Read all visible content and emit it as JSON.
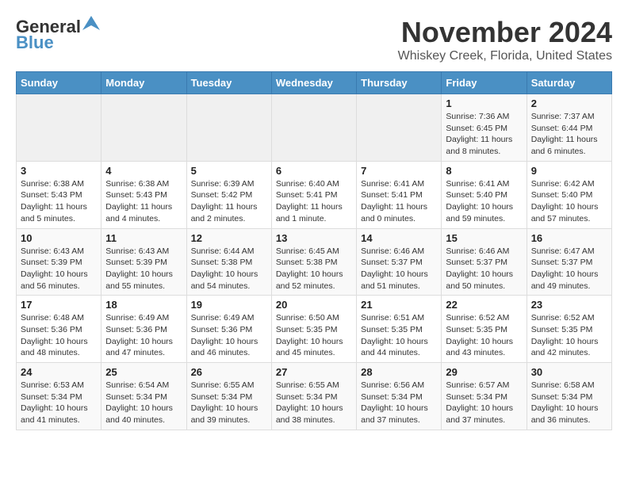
{
  "header": {
    "logo_general": "General",
    "logo_blue": "Blue",
    "month": "November 2024",
    "location": "Whiskey Creek, Florida, United States"
  },
  "weekdays": [
    "Sunday",
    "Monday",
    "Tuesday",
    "Wednesday",
    "Thursday",
    "Friday",
    "Saturday"
  ],
  "weeks": [
    [
      {
        "day": "",
        "info": ""
      },
      {
        "day": "",
        "info": ""
      },
      {
        "day": "",
        "info": ""
      },
      {
        "day": "",
        "info": ""
      },
      {
        "day": "",
        "info": ""
      },
      {
        "day": "1",
        "info": "Sunrise: 7:36 AM\nSunset: 6:45 PM\nDaylight: 11 hours\nand 8 minutes."
      },
      {
        "day": "2",
        "info": "Sunrise: 7:37 AM\nSunset: 6:44 PM\nDaylight: 11 hours\nand 6 minutes."
      }
    ],
    [
      {
        "day": "3",
        "info": "Sunrise: 6:38 AM\nSunset: 5:43 PM\nDaylight: 11 hours\nand 5 minutes."
      },
      {
        "day": "4",
        "info": "Sunrise: 6:38 AM\nSunset: 5:43 PM\nDaylight: 11 hours\nand 4 minutes."
      },
      {
        "day": "5",
        "info": "Sunrise: 6:39 AM\nSunset: 5:42 PM\nDaylight: 11 hours\nand 2 minutes."
      },
      {
        "day": "6",
        "info": "Sunrise: 6:40 AM\nSunset: 5:41 PM\nDaylight: 11 hours\nand 1 minute."
      },
      {
        "day": "7",
        "info": "Sunrise: 6:41 AM\nSunset: 5:41 PM\nDaylight: 11 hours\nand 0 minutes."
      },
      {
        "day": "8",
        "info": "Sunrise: 6:41 AM\nSunset: 5:40 PM\nDaylight: 10 hours\nand 59 minutes."
      },
      {
        "day": "9",
        "info": "Sunrise: 6:42 AM\nSunset: 5:40 PM\nDaylight: 10 hours\nand 57 minutes."
      }
    ],
    [
      {
        "day": "10",
        "info": "Sunrise: 6:43 AM\nSunset: 5:39 PM\nDaylight: 10 hours\nand 56 minutes."
      },
      {
        "day": "11",
        "info": "Sunrise: 6:43 AM\nSunset: 5:39 PM\nDaylight: 10 hours\nand 55 minutes."
      },
      {
        "day": "12",
        "info": "Sunrise: 6:44 AM\nSunset: 5:38 PM\nDaylight: 10 hours\nand 54 minutes."
      },
      {
        "day": "13",
        "info": "Sunrise: 6:45 AM\nSunset: 5:38 PM\nDaylight: 10 hours\nand 52 minutes."
      },
      {
        "day": "14",
        "info": "Sunrise: 6:46 AM\nSunset: 5:37 PM\nDaylight: 10 hours\nand 51 minutes."
      },
      {
        "day": "15",
        "info": "Sunrise: 6:46 AM\nSunset: 5:37 PM\nDaylight: 10 hours\nand 50 minutes."
      },
      {
        "day": "16",
        "info": "Sunrise: 6:47 AM\nSunset: 5:37 PM\nDaylight: 10 hours\nand 49 minutes."
      }
    ],
    [
      {
        "day": "17",
        "info": "Sunrise: 6:48 AM\nSunset: 5:36 PM\nDaylight: 10 hours\nand 48 minutes."
      },
      {
        "day": "18",
        "info": "Sunrise: 6:49 AM\nSunset: 5:36 PM\nDaylight: 10 hours\nand 47 minutes."
      },
      {
        "day": "19",
        "info": "Sunrise: 6:49 AM\nSunset: 5:36 PM\nDaylight: 10 hours\nand 46 minutes."
      },
      {
        "day": "20",
        "info": "Sunrise: 6:50 AM\nSunset: 5:35 PM\nDaylight: 10 hours\nand 45 minutes."
      },
      {
        "day": "21",
        "info": "Sunrise: 6:51 AM\nSunset: 5:35 PM\nDaylight: 10 hours\nand 44 minutes."
      },
      {
        "day": "22",
        "info": "Sunrise: 6:52 AM\nSunset: 5:35 PM\nDaylight: 10 hours\nand 43 minutes."
      },
      {
        "day": "23",
        "info": "Sunrise: 6:52 AM\nSunset: 5:35 PM\nDaylight: 10 hours\nand 42 minutes."
      }
    ],
    [
      {
        "day": "24",
        "info": "Sunrise: 6:53 AM\nSunset: 5:34 PM\nDaylight: 10 hours\nand 41 minutes."
      },
      {
        "day": "25",
        "info": "Sunrise: 6:54 AM\nSunset: 5:34 PM\nDaylight: 10 hours\nand 40 minutes."
      },
      {
        "day": "26",
        "info": "Sunrise: 6:55 AM\nSunset: 5:34 PM\nDaylight: 10 hours\nand 39 minutes."
      },
      {
        "day": "27",
        "info": "Sunrise: 6:55 AM\nSunset: 5:34 PM\nDaylight: 10 hours\nand 38 minutes."
      },
      {
        "day": "28",
        "info": "Sunrise: 6:56 AM\nSunset: 5:34 PM\nDaylight: 10 hours\nand 37 minutes."
      },
      {
        "day": "29",
        "info": "Sunrise: 6:57 AM\nSunset: 5:34 PM\nDaylight: 10 hours\nand 37 minutes."
      },
      {
        "day": "30",
        "info": "Sunrise: 6:58 AM\nSunset: 5:34 PM\nDaylight: 10 hours\nand 36 minutes."
      }
    ]
  ]
}
